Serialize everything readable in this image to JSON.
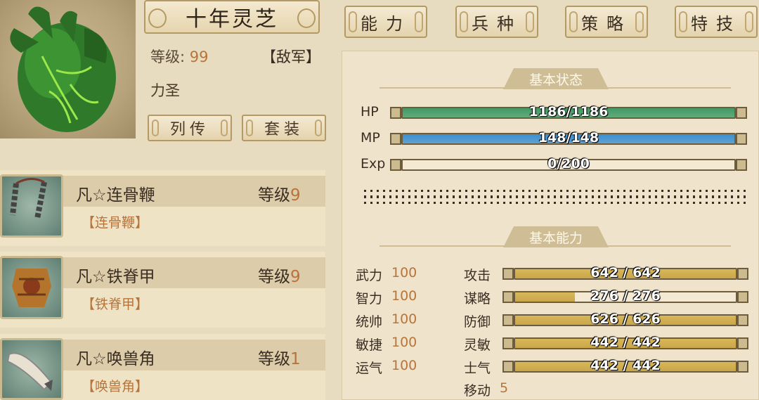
{
  "unit": {
    "name": "十年灵芝",
    "level_label": "等级:",
    "level": "99",
    "faction": "【敌军】",
    "title": "力圣"
  },
  "tabs": [
    "能力",
    "兵种",
    "策略",
    "特技"
  ],
  "buttons": {
    "biography": "列传",
    "equipment_set": "套装"
  },
  "equipment": [
    {
      "name": "凡☆连骨鞭",
      "level_label": "等级",
      "level": "9",
      "type": "【连骨鞭】"
    },
    {
      "name": "凡☆铁脊甲",
      "level_label": "等级",
      "level": "9",
      "type": "【铁脊甲】"
    },
    {
      "name": "凡☆唤兽角",
      "level_label": "等级",
      "level": "1",
      "type": "【唤兽角】"
    }
  ],
  "status": {
    "header": "基本状态",
    "bars": [
      {
        "label": "HP",
        "text": "1186/1186",
        "fill": 1.0,
        "color": "#3f9a64"
      },
      {
        "label": "MP",
        "text": "148/148",
        "fill": 1.0,
        "color": "#3b8fd0"
      },
      {
        "label": "Exp",
        "text": "0/200",
        "fill": 0.0,
        "color": "#c9a64a"
      }
    ]
  },
  "abilities": {
    "header": "基本能力",
    "base": [
      {
        "label": "武力",
        "value": "100"
      },
      {
        "label": "智力",
        "value": "100"
      },
      {
        "label": "统帅",
        "value": "100"
      },
      {
        "label": "敏捷",
        "value": "100"
      },
      {
        "label": "运气",
        "value": "100"
      }
    ],
    "derived": [
      {
        "label": "攻击",
        "text": "642 / 642",
        "fill": 1.0
      },
      {
        "label": "谋略",
        "text": "276 / 276",
        "fill": 0.27
      },
      {
        "label": "防御",
        "text": "626 / 626",
        "fill": 1.0
      },
      {
        "label": "灵敏",
        "text": "442 / 442",
        "fill": 1.0
      },
      {
        "label": "士气",
        "text": "442 / 442",
        "fill": 1.0
      }
    ],
    "move_label": "移动",
    "move_value": "5"
  },
  "colors": {
    "accent": "#b8743a",
    "gold_bar": "#c9a64a"
  }
}
